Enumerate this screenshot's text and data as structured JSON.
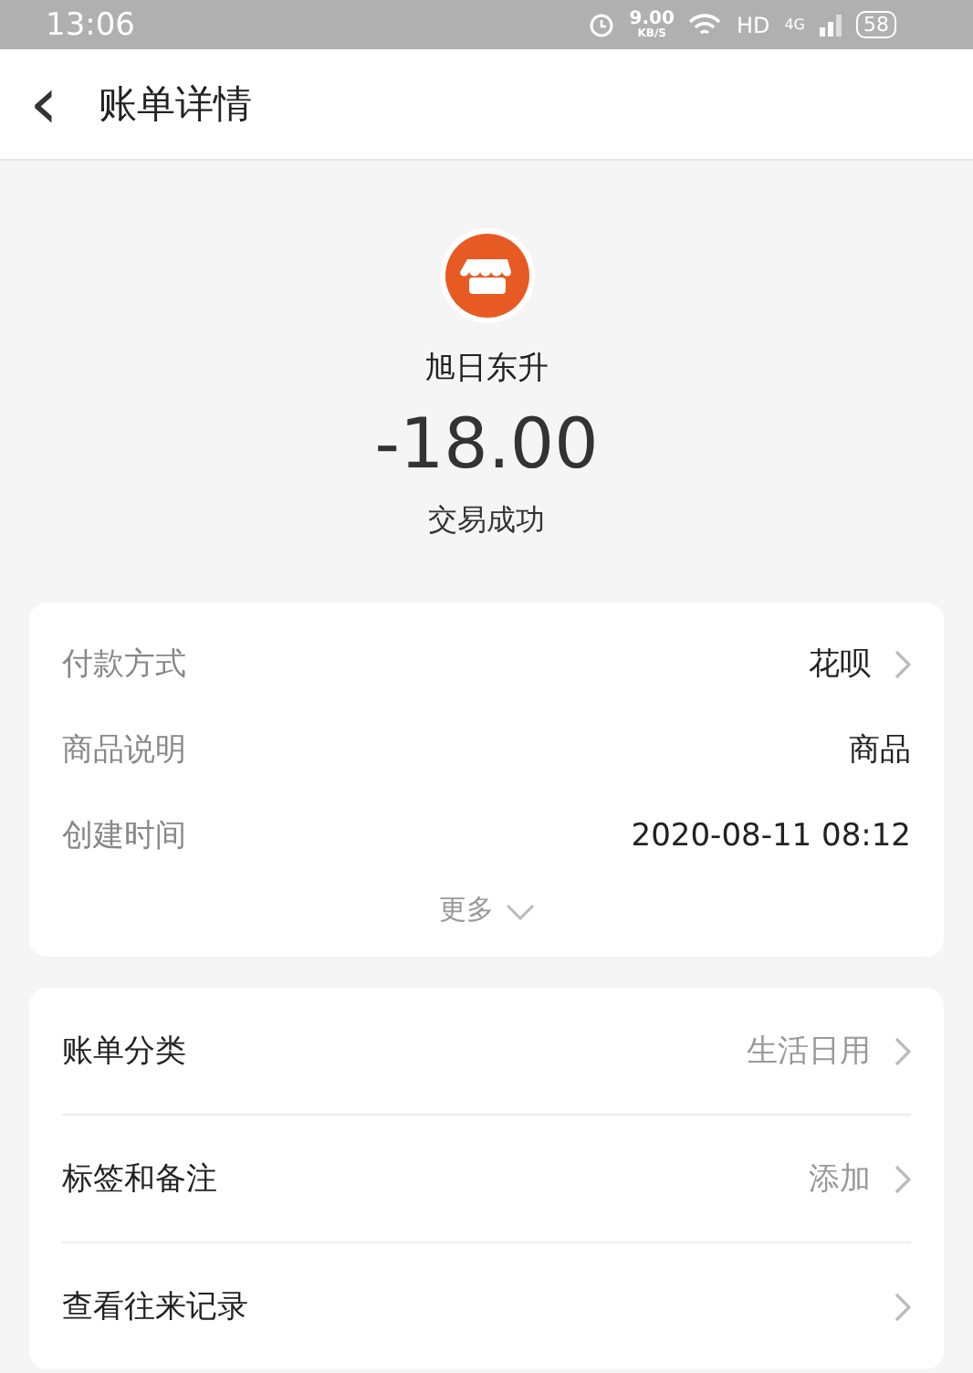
{
  "status_bar": {
    "time": "13:06",
    "speed": "9.00",
    "speed_unit": "KB/S",
    "hd": "HD",
    "network": "4G",
    "battery": "58"
  },
  "header": {
    "back": "‹",
    "title": "账单详情"
  },
  "summary": {
    "merchant": "旭日东升",
    "amount": "-18.00",
    "status": "交易成功"
  },
  "details": [
    {
      "label": "付款方式",
      "value": "花呗",
      "arrow": true
    },
    {
      "label": "商品说明",
      "value": "商品",
      "arrow": false
    },
    {
      "label": "创建时间",
      "value": "2020-08-11 08:12",
      "arrow": false
    }
  ],
  "more": "更多",
  "actions": [
    {
      "label": "账单分类",
      "value": "生活日用"
    },
    {
      "label": "标签和备注",
      "value": "添加"
    },
    {
      "label": "查看往来记录"
    }
  ]
}
